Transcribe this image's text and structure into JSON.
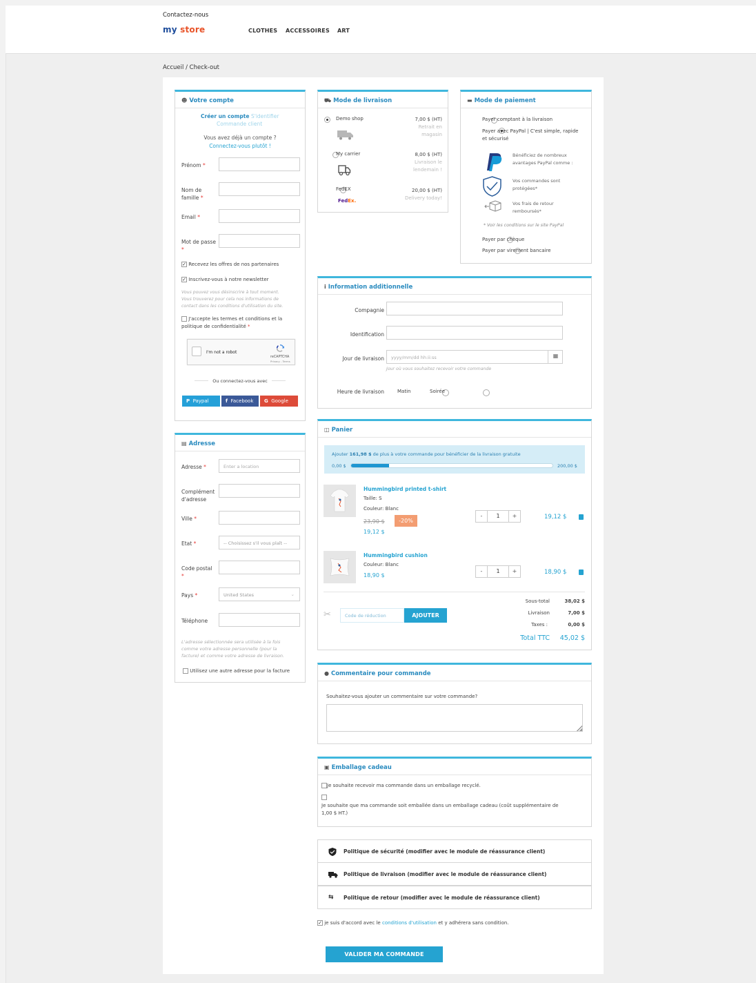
{
  "header": {
    "contact": "Contactez-nous",
    "logo_my": "my",
    "logo_store": "store",
    "nav": [
      "CLOTHES",
      "ACCESSOIRES",
      "ART"
    ]
  },
  "breadcrumb": {
    "home": "Accueil",
    "sep": "/",
    "current": "Check-out"
  },
  "account": {
    "title": "Votre compte",
    "tab_create": "Créer un compte",
    "tab_login": "S'identifier",
    "tab_guest": "Commande client",
    "have_account": "Vous avez déjà un compte ?",
    "login_link": "Connectez-vous plutôt !",
    "firstname": "Prénom",
    "lastname_1": "Nom de",
    "lastname_2": "famille",
    "email": "Email",
    "password": "Mot de passe",
    "req": "*",
    "optin": "Recevez les offres de nos partenaires",
    "newsletter": "Inscrivez-vous à notre newsletter",
    "unsub_1": "Vous pouvez vous désinscrire à tout moment.",
    "unsub_2": "Vous trouverez pour cela nos informations de",
    "unsub_3": "contact dans les conditions d'utilisation du site.",
    "terms_1": "J'accepte les termes et conditions et la",
    "terms_2": "politique de confidentialité",
    "captcha": "I'm not a robot",
    "captcha_brand": "reCAPTCHA",
    "captcha_links": "Privacy - Terms",
    "or_connect": "Ou connectez-vous avec",
    "social": [
      "Paypal",
      "Facebook",
      "Google"
    ]
  },
  "address": {
    "title": "Adresse",
    "address": "Adresse",
    "address_ph": "Enter a location",
    "complement_1": "Complément",
    "complement_2": "d'adresse",
    "city": "Ville",
    "state": "Etat",
    "state_value": "-- Choisissez s'il vous plaît --",
    "postcode_1": "Code postal",
    "country": "Pays",
    "country_value": "United States",
    "phone": "Téléphone",
    "note_1": "L'adresse sélectionnée sera utilisée à la fois",
    "note_2": "comme votre adresse personnelle (pour la",
    "note_3": "facture) et comme votre adresse de livraison.",
    "other_invoice": "Utilisez une autre adresse pour la facture"
  },
  "shipping": {
    "title": "Mode de livraison",
    "carriers": [
      {
        "name": "Demo shop",
        "price": "7,00 $ (HT)",
        "delay_1": "Retrait en",
        "delay_2": "magasin"
      },
      {
        "name": "My carrier",
        "price": "8,00 $ (HT)",
        "delay_1": "Livraison le",
        "delay_2": "lendemain !"
      },
      {
        "name": "FedEX",
        "price": "20,00 $ (HT)",
        "delay_1": "Delivery today!",
        "delay_2": ""
      }
    ],
    "fedex_fed": "Fed",
    "fedex_ex": "Ex."
  },
  "payment": {
    "title": "Mode de paiement",
    "cod": "Payer comptant à la livraison",
    "paypal_1": "Payer avec PayPal | C'est simple, rapide",
    "paypal_2": "et sécurisé",
    "benefit1_1": "Bénéficiez de nombreux",
    "benefit1_2": "avantages PayPal comme :",
    "benefit2_1": "Vos commandes sont",
    "benefit2_2": "protégées*",
    "benefit3_1": "Vos frais de retour",
    "benefit3_2": "remboursés*",
    "conditions": "* Voir les conditions sur le site PayPal",
    "cheque": "Payer par chèque",
    "wire": "Payer par virement bancaire"
  },
  "info": {
    "title": "Information additionnelle",
    "company": "Compagnie",
    "identification": "Identification",
    "delivery_day": "Jour de livraison",
    "delivery_day_ph": "yyyy/mm/dd hh:ii:ss",
    "delivery_day_hint": "Jour où vous souhaitez recevoir votre commande",
    "delivery_time": "Heure de livraison",
    "morning": "Matin",
    "evening": "Soirée"
  },
  "cart": {
    "title": "Panier",
    "promo_1": "Ajouter",
    "promo_amount": "161,98 $",
    "promo_2": "de plus à votre commande pour bénéficier de la livraison gratuite",
    "bar_min": "0,00 $",
    "bar_max": "200,00 $",
    "progress": 0.19,
    "items": [
      {
        "name": "Hummingbird printed t-shirt",
        "size": "Taille: S",
        "color": "Couleur: Blanc",
        "old_price": "23,90 $",
        "discount": "-20%",
        "price": "19,12 $",
        "qty": "1",
        "total": "19,12 $"
      },
      {
        "name": "Hummingbird cushion",
        "color": "Couleur: Blanc",
        "price": "18,90 $",
        "qty": "1",
        "total": "18,90 $"
      }
    ],
    "minus": "-",
    "plus": "+",
    "voucher_ph": "Code de réduction",
    "voucher_btn": "AJOUTER",
    "subtotal_label": "Sous-total",
    "subtotal": "38,02 $",
    "shipping_label": "Livraison",
    "shipping": "7,00 $",
    "taxes_label": "Taxes :",
    "taxes": "0,00 $",
    "total_label": "Total TTC",
    "total": "45,02 $"
  },
  "comment": {
    "title": "Commentaire pour commande",
    "question": "Souhaitez-vous ajouter un commentaire sur votre commande?"
  },
  "gift": {
    "title": "Emballage cadeau",
    "recycled": "Je souhaite recevoir ma commande dans un emballage recyclé.",
    "wrap_1": "Je souhaite que ma commande soit emballée dans un emballage cadeau (coût supplémentaire de",
    "wrap_2": "1,00 $ HT.)"
  },
  "reassurance": [
    "Politique de sécurité (modifier avec le module de réassurance client)",
    "Politique de livraison (modifier avec le module de réassurance client)",
    "Politique de retour (modifier avec le module de réassurance client)"
  ],
  "agree": {
    "pre": "je suis d'accord avec le",
    "link": "conditions d'utilisation",
    "post": "et y adhérera sans condition."
  },
  "submit": "VALIDER MA COMMANDE",
  "colors": {
    "accent": "#25a3d1",
    "discount": "#f39d72",
    "paypal": "#25a0d8",
    "facebook": "#3b5998",
    "google": "#dd4b39"
  }
}
